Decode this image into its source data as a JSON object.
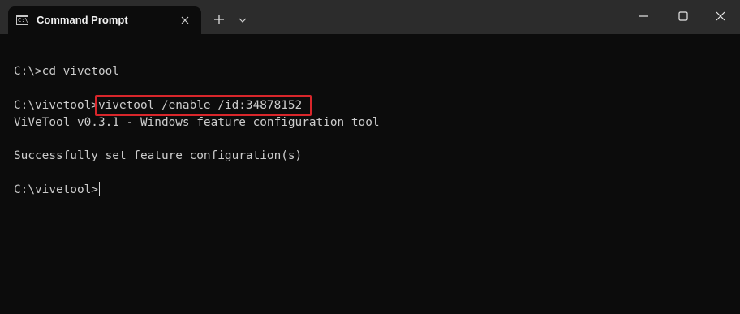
{
  "window": {
    "tab_title": "Command Prompt",
    "tab_icon_glyph": "C:\\",
    "icons": {
      "tab": "cmd-icon",
      "tab_close": "close-icon",
      "new_tab": "plus-icon",
      "dropdown": "chevron-down-icon",
      "minimize": "minimize-icon",
      "maximize": "maximize-icon",
      "close": "close-icon"
    }
  },
  "console": {
    "lines": [
      "C:\\>cd vivetool",
      "",
      "C:\\vivetool>vivetool /enable /id:34878152",
      "ViVeTool v0.3.1 - Windows feature configuration tool",
      "",
      "Successfully set feature configuration(s)",
      "",
      "C:\\vivetool>"
    ],
    "prompt_3": "C:\\vivetool>",
    "command_3": "vivetool /enable /id:34878152",
    "final_prompt": "C:\\vivetool>"
  },
  "colors": {
    "background": "#0c0c0c",
    "titlebar": "#2c2c2c",
    "text": "#cccccc",
    "highlight": "#d9262b"
  }
}
